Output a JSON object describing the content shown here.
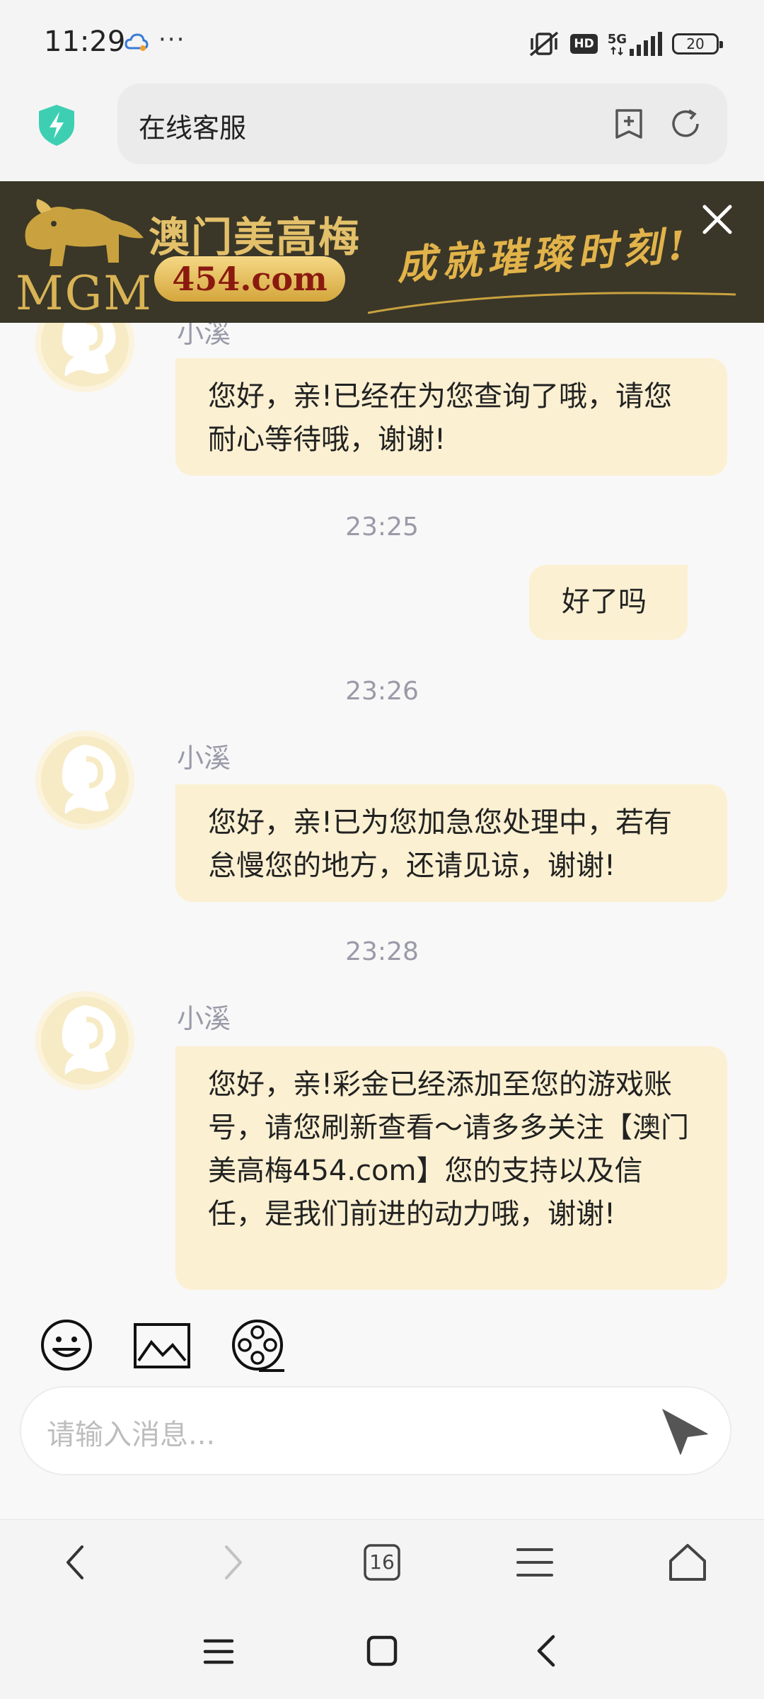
{
  "status_bar": {
    "time": "11:29",
    "more": "···",
    "hd": "HD",
    "network": "5G",
    "battery": "20"
  },
  "browser": {
    "page_title": "在线客服"
  },
  "ad_banner": {
    "logo_text": "MGM",
    "brand": "澳门美高梅",
    "domain": "454.com",
    "slogan": "成就璀璨时刻!"
  },
  "chat": {
    "messages": [
      {
        "from": "agent",
        "name": "小溪",
        "text": "您好，亲!已经在为您查询了哦，请您耐心等待哦，谢谢!"
      },
      {
        "timestamp": "23:25"
      },
      {
        "from": "user",
        "text": "好了吗"
      },
      {
        "timestamp": "23:26"
      },
      {
        "from": "agent",
        "name": "小溪",
        "text": "您好，亲!已为您加急您处理中，若有怠慢您的地方，还请见谅，谢谢!"
      },
      {
        "timestamp": "23:28"
      },
      {
        "from": "agent",
        "name": "小溪",
        "text": "您好，亲!彩金已经添加至您的游戏账号，请您刷新查看～请多多关注【澳门美高梅454.com】您的支持以及信任，是我们前进的动力哦，谢谢!"
      }
    ]
  },
  "composer": {
    "placeholder": "请输入消息..."
  },
  "browser_nav": {
    "tab_count": "16"
  },
  "colors": {
    "bubble": "#fbf0d2",
    "avatar_bg": "#fbf3dc",
    "banner_bg": "#3a3728",
    "gold": "#d9b455",
    "shield": "#3ecfb2"
  }
}
